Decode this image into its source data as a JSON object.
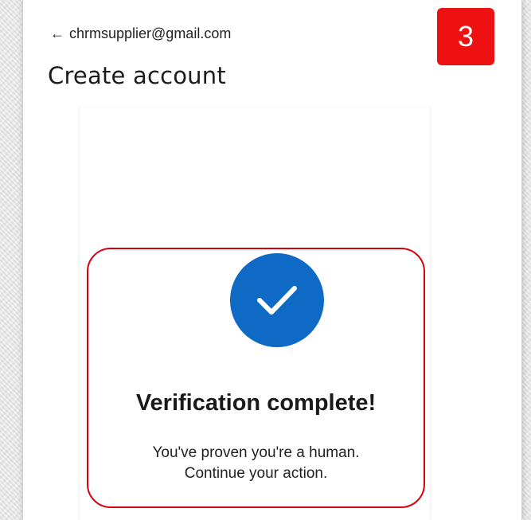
{
  "header": {
    "back_arrow": "←",
    "email": "chrmsupplier@gmail.com",
    "title": "Create account"
  },
  "step_badge": {
    "number": "3",
    "color": "#ee1111"
  },
  "verification": {
    "icon": "checkmark-icon",
    "icon_color": "#0f6ac5",
    "title": "Verification complete!",
    "message_line1": "You've proven you're a human.",
    "message_line2": "Continue your action.",
    "highlight_color": "#d9000d"
  }
}
